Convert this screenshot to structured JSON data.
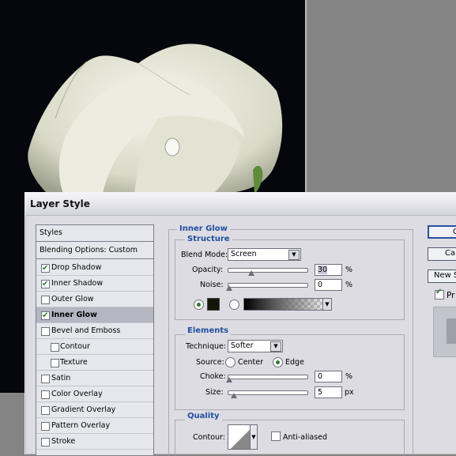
{
  "canvas": {
    "image": "white rose photo"
  },
  "dialog": {
    "title": "Layer Style",
    "styles_list": {
      "header": "Styles",
      "blending": "Blending Options: Custom",
      "items": [
        {
          "label": "Drop Shadow",
          "checked": true,
          "indent": false
        },
        {
          "label": "Inner Shadow",
          "checked": true,
          "indent": false
        },
        {
          "label": "Outer Glow",
          "checked": false,
          "indent": false
        },
        {
          "label": "Inner Glow",
          "checked": true,
          "indent": false
        },
        {
          "label": "Bevel and Emboss",
          "checked": false,
          "indent": false
        },
        {
          "label": "Contour",
          "checked": false,
          "indent": true
        },
        {
          "label": "Texture",
          "checked": false,
          "indent": true
        },
        {
          "label": "Satin",
          "checked": false,
          "indent": false
        },
        {
          "label": "Color Overlay",
          "checked": false,
          "indent": false
        },
        {
          "label": "Gradient Overlay",
          "checked": false,
          "indent": false
        },
        {
          "label": "Pattern Overlay",
          "checked": false,
          "indent": false
        },
        {
          "label": "Stroke",
          "checked": false,
          "indent": false
        }
      ],
      "active": "Inner Glow"
    },
    "panel_title": "Inner Glow",
    "structure": {
      "title": "Structure",
      "blend_mode_label": "Blend Mode:",
      "blend_mode_value": "Screen",
      "opacity_label": "Opacity:",
      "opacity_value": "30",
      "opacity_unit": "%",
      "opacity_fraction": 0.3,
      "noise_label": "Noise:",
      "noise_value": "0",
      "noise_unit": "%",
      "glow_color": "#161408"
    },
    "elements": {
      "title": "Elements",
      "technique_label": "Technique:",
      "technique_value": "Softer",
      "source_label": "Source:",
      "source_center": "Center",
      "source_edge": "Edge",
      "choke_label": "Choke:",
      "choke_value": "0",
      "choke_unit": "%",
      "size_label": "Size:",
      "size_value": "5",
      "size_unit": "px"
    },
    "quality": {
      "title": "Quality",
      "contour_label": "Contour:",
      "antialiased_label": "Anti-aliased"
    },
    "buttons": {
      "ok": "C",
      "cancel": "Can",
      "new_style": "New S",
      "preview_label": "Pr"
    }
  }
}
